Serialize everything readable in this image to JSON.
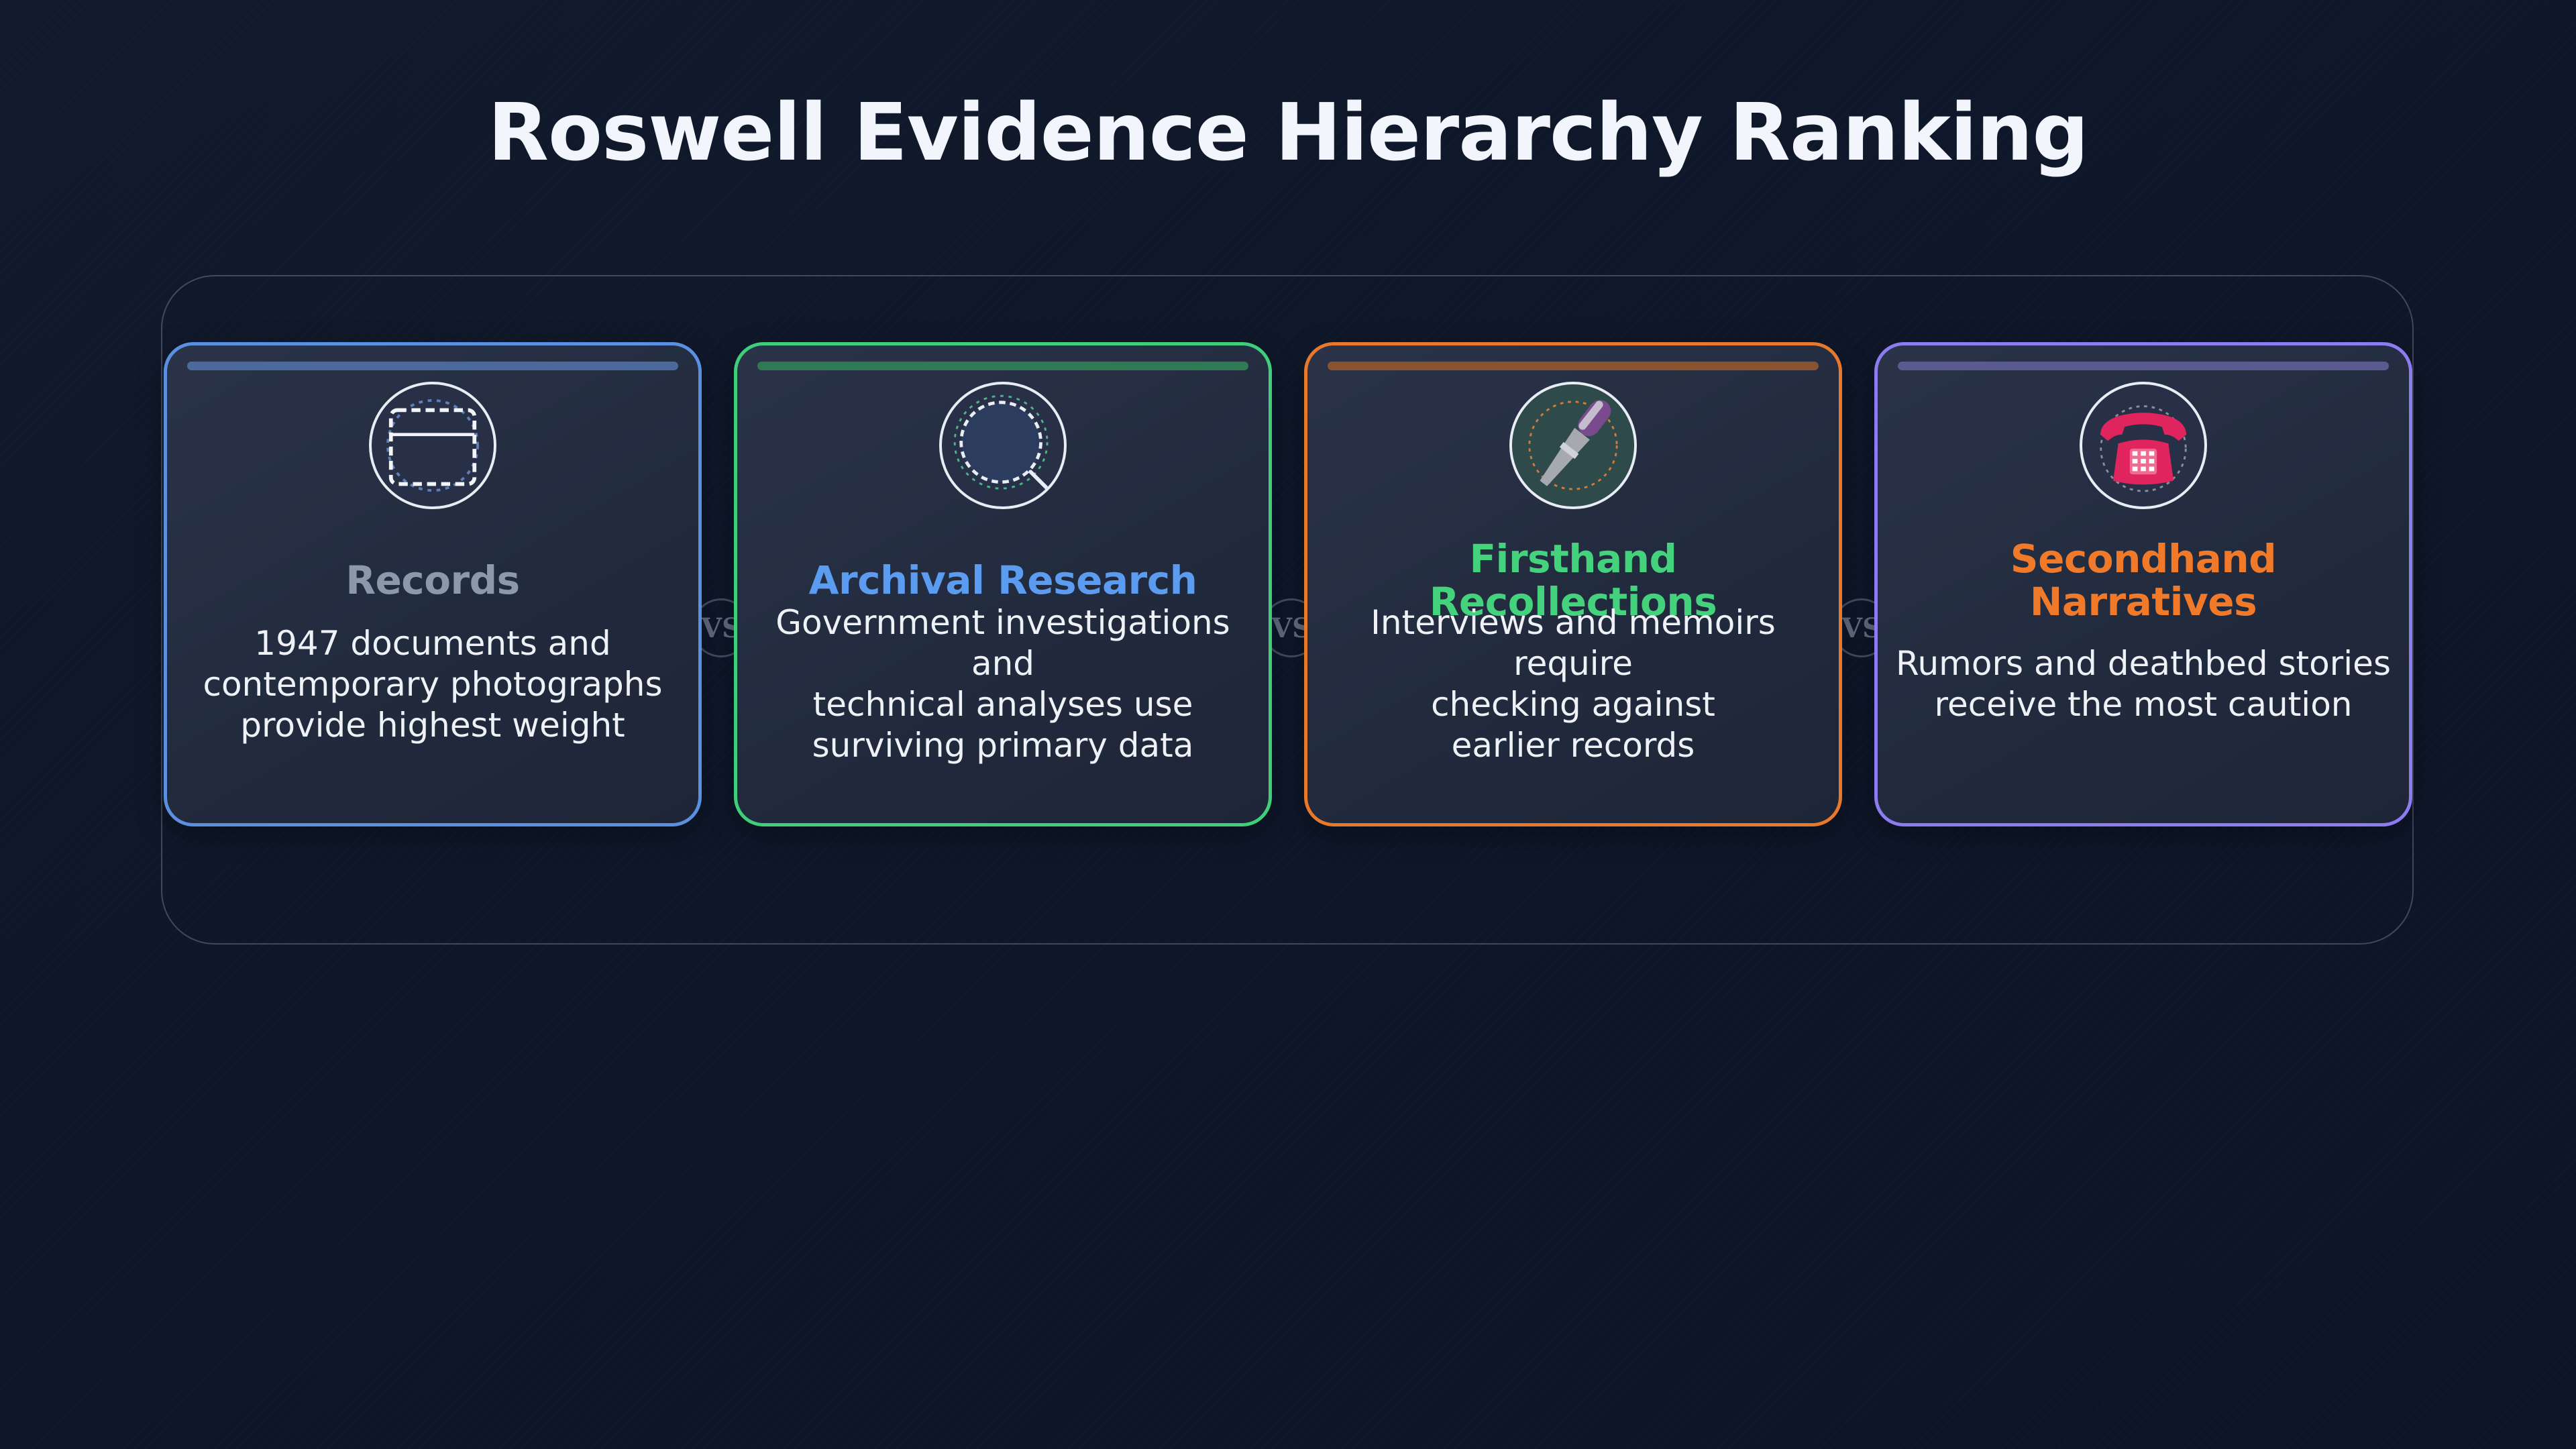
{
  "title": "Roswell Evidence Hierarchy Ranking",
  "separator_label": "VS",
  "cards": [
    {
      "name": "Records",
      "description": "1947 documents and\ncontemporary photographs\nprovide highest weight",
      "icon": "document-frame-icon",
      "border_color": "#5b8fe0",
      "bar_color": "#4a6a9e",
      "name_color": "#8d98ab"
    },
    {
      "name": "Archival Research",
      "description": "Government investigations and\ntechnical analyses use\nsurviving primary data",
      "icon": "magnifier-icon",
      "border_color": "#3fcf7a",
      "bar_color": "#2f7a55",
      "name_color": "#5b9cf0"
    },
    {
      "name": "Firsthand\nRecollections",
      "description": "Interviews and memoirs require\nchecking against\nearlier records",
      "icon": "microphone-icon",
      "border_color": "#e8782c",
      "bar_color": "#8a5330",
      "name_color": "#45d27c"
    },
    {
      "name": "Secondhand Narratives",
      "description": "Rumors and deathbed stories\nreceive the most caution",
      "icon": "telephone-icon",
      "border_color": "#8c7cf0",
      "bar_color": "#5a5a90",
      "name_color": "#f07a2a"
    }
  ]
}
